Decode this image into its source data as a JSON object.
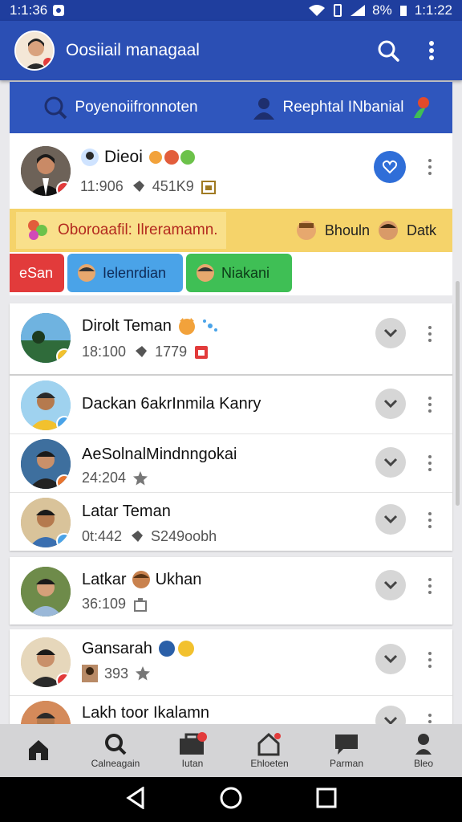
{
  "status_bar": {
    "time": "1:1:36",
    "battery": "8%",
    "clock_right": "1:1:22"
  },
  "app_bar": {
    "title": "Oosiiail managaal"
  },
  "tabs": [
    {
      "label": "Poyenoiifronnoten",
      "icon": "search-icon"
    },
    {
      "label": "Reephtal INbanial",
      "icon": "person-icon"
    }
  ],
  "featured": {
    "name": "Dieoi",
    "meta_time": "11:906",
    "meta_count": "451K9"
  },
  "banner": {
    "main_text": "Oboroaafil: Ilreramamn.",
    "item1": "Bhouln",
    "item2": "Datk"
  },
  "chips": [
    {
      "label": "eSan",
      "color": "#e23b3b"
    },
    {
      "label": "Ielenrdian",
      "color": "#4aa3e8"
    },
    {
      "label": "Niakani",
      "color": "#3fbf55"
    }
  ],
  "contacts": [
    {
      "name": "Dirolt Teman",
      "time": "18:100",
      "count": "1779"
    },
    {
      "name": "Dackan 6akrInmila Kanry",
      "time": "",
      "count": ""
    },
    {
      "name": "AeSolnalMindnngokai",
      "time": "24:204",
      "count": ""
    },
    {
      "name": "Latar Teman",
      "time": "0t:442",
      "count": "S249oobh"
    },
    {
      "name": "Latkar",
      "name2": "Ukhan",
      "time": "36:109",
      "count": ""
    },
    {
      "name": "Gansarah",
      "time": "",
      "count": "393"
    },
    {
      "name": "Lakh toor Ikalamn",
      "time": "",
      "count": ""
    }
  ],
  "bottom_nav": [
    {
      "label": "",
      "icon": "home-icon"
    },
    {
      "label": "Calneagain",
      "icon": "search-icon"
    },
    {
      "label": "Iutan",
      "icon": "briefcase-icon"
    },
    {
      "label": "Ehloeten",
      "icon": "house-alert-icon"
    },
    {
      "label": "Parman",
      "icon": "chat-icon"
    },
    {
      "label": "Bleo",
      "icon": "person-pin-icon"
    }
  ]
}
